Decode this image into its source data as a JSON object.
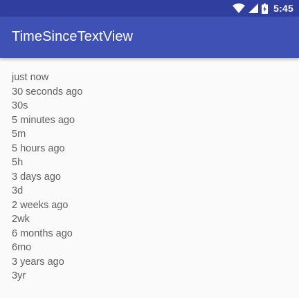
{
  "status_bar": {
    "time": "5:45",
    "icons": [
      "wifi-icon",
      "cellular-signal-icon",
      "battery-charging-icon"
    ],
    "color": "#303f9f"
  },
  "app_bar": {
    "title": "TimeSinceTextView",
    "color": "#3f51b5"
  },
  "items": [
    "just now",
    "30 seconds ago",
    "30s",
    "5 minutes ago",
    "5m",
    "5 hours ago",
    "5h",
    "3 days ago",
    "3d",
    "2 weeks ago",
    "2wk",
    "6 months ago",
    "6mo",
    "3 years ago",
    "3yr"
  ]
}
